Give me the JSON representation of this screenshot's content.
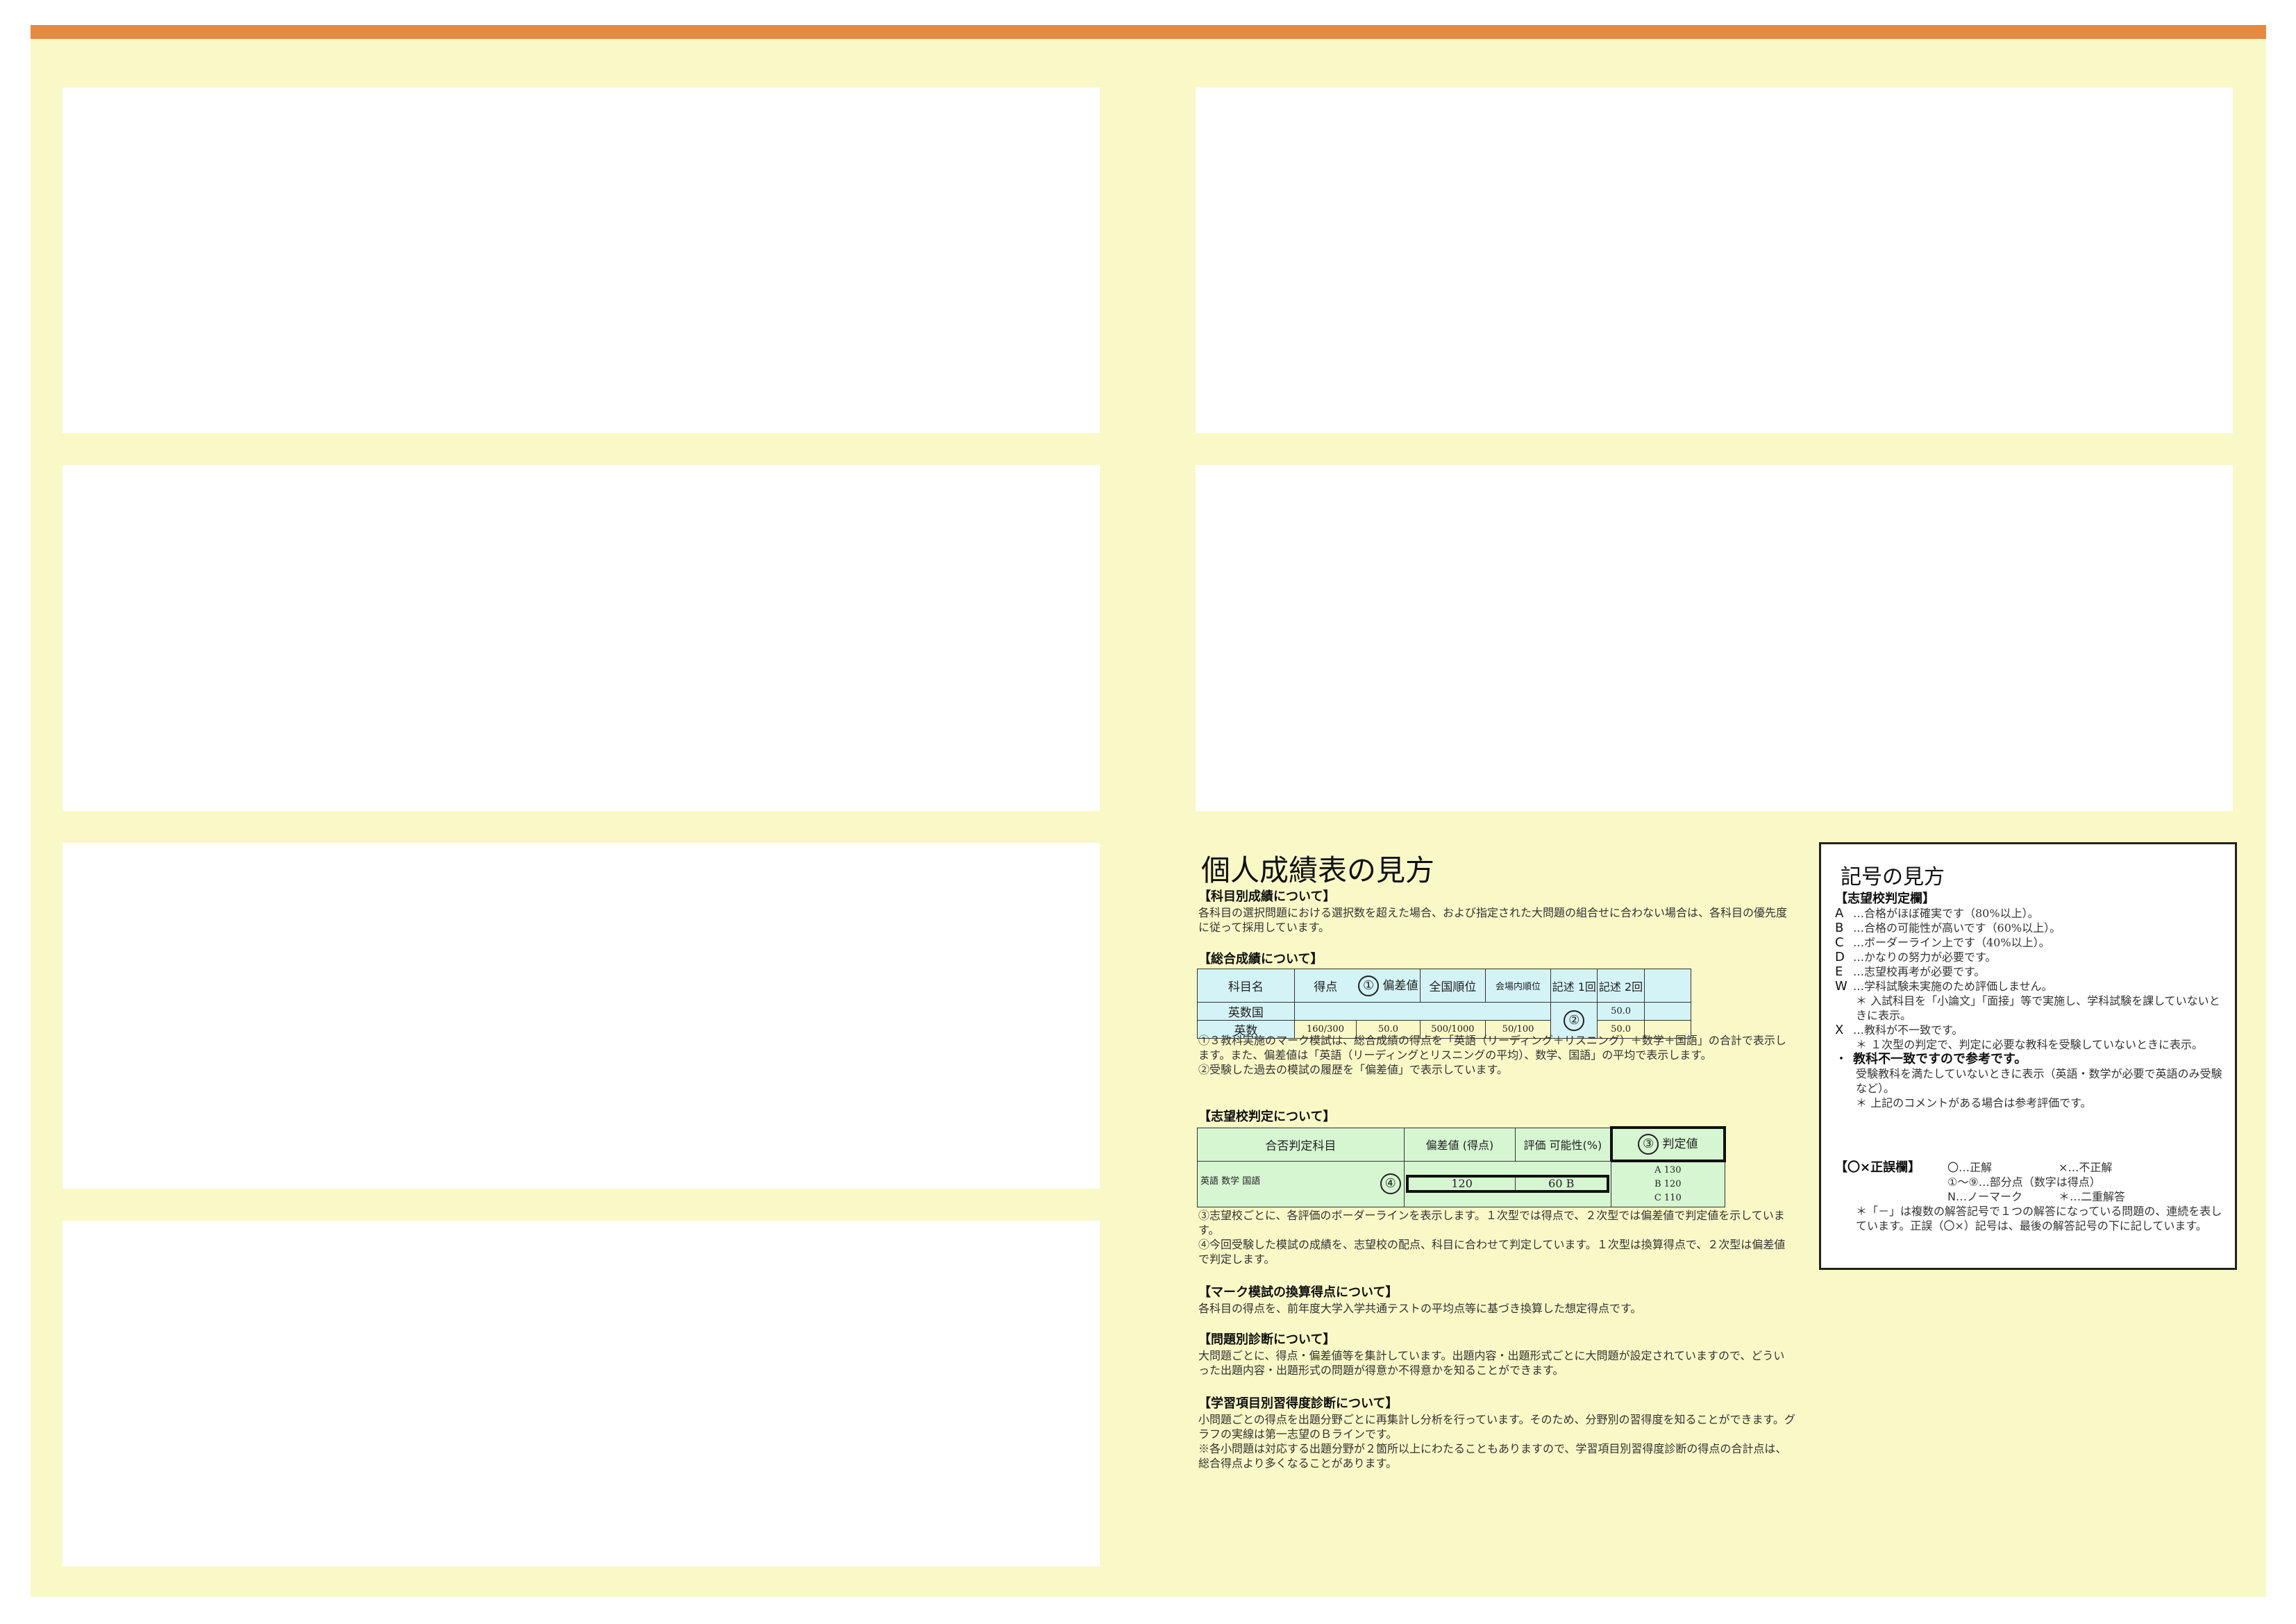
{
  "guide": {
    "title": "個人成績表の見方",
    "subject": {
      "heading": "【科目別成績について】",
      "text": "各科目の選択問題における選択数を超えた場合、および指定された大問題の組合せに合わない場合は、各科目の優先度に従って採用しています。"
    },
    "total": {
      "heading": "【総合成績について】",
      "table": {
        "h_subject": "科目名",
        "h_score": "得点",
        "h_dev": "偏差値",
        "h_nat": "全国順位",
        "h_site": "会場内順位",
        "h_k1": "記述 1回",
        "h_k2": "記述 2回",
        "row1": "英数国",
        "row2": "英数",
        "score": "160/300",
        "dev": "50.0",
        "nat": "500/1000",
        "site": "50/100",
        "k2a": "50.0",
        "k2b": "50.0"
      },
      "note1": "①３教科実施のマーク模試は、総合成績の得点を「英語（リーディング＋リスニング）＋数学＋国語」の合計で表示します。また、偏差値は「英語（リーディングとリスニングの平均）、数学、国語」の平均で表示します。",
      "note2": "②受験した過去の模試の履歴を「偏差値」で表示しています。"
    },
    "judge": {
      "heading": "【志望校判定について】",
      "table": {
        "h_subj": "合否判定科目",
        "h_dev": "偏差値 (得点)",
        "h_eval": "評価 可能性(%)",
        "h_val": "判定値",
        "subjects": "英語 数学 国語",
        "dev": "120",
        "eval": "60 B",
        "lines": [
          "A 130",
          "B 120",
          "C 110"
        ]
      },
      "note3": "③志望校ごとに、各評価のボーダーラインを表示します。１次型では得点で、２次型では偏差値で判定値を示しています。",
      "note4": "④今回受験した模試の成績を、志望校の配点、科目に合わせて判定しています。１次型は換算得点で、２次型は偏差値で判定します。"
    },
    "converted": {
      "heading": "【マーク模試の換算得点について】",
      "text": "各科目の得点を、前年度大学入学共通テストの平均点等に基づき換算した想定得点です。"
    },
    "question": {
      "heading": "【問題別診断について】",
      "text": "大問題ごとに、得点・偏差値等を集計しています。出題内容・出題形式ごとに大問題が設定されていますので、どういった出題内容・出題形式の問題が得意か不得意かを知ることができます。"
    },
    "learning": {
      "heading": "【学習項目別習得度診断について】",
      "text1": "小問題ごとの得点を出題分野ごとに再集計し分析を行っています。そのため、分野別の習得度を知ることができます。グラフの実線は第一志望のＢラインです。",
      "text2": "※各小問題は対応する出題分野が２箇所以上にわたることもありますので、学習項目別習得度診断の得点の合計点は、総合得点より多くなることがあります。"
    },
    "markers": [
      "①",
      "②",
      "③",
      "④"
    ]
  },
  "legend": {
    "title": "記号の見方",
    "judge_heading": "【志望校判定欄】",
    "items": [
      {
        "code": "A",
        "text": "…合格がほぼ確実です（80%以上）。"
      },
      {
        "code": "B",
        "text": "…合格の可能性が高いです（60%以上）。"
      },
      {
        "code": "C",
        "text": "…ボーダーライン上です（40%以上）。"
      },
      {
        "code": "D",
        "text": "…かなりの努力が必要です。"
      },
      {
        "code": "E",
        "text": "…志望校再考が必要です。"
      },
      {
        "code": "W",
        "text": "…学科試験未実施のため評価しません。"
      }
    ],
    "w_note": "＊ 入試科目を「小論文」「面接」等で実施し、学科試験を課していないときに表示。",
    "x_code": "X",
    "x_text": "…教科が不一致です。",
    "x_note": "＊ １次型の判定で、判定に必要な教科を受験していないときに表示。",
    "dot_code": "・",
    "dot_text": "教科不一致ですので参考です。",
    "dot_note1": "受験教科を満たしていないときに表示（英語・数学が必要で英語のみ受験など）。",
    "dot_note2": "＊ 上記のコメントがある場合は参考評価です。",
    "ox_heading": "【〇×正誤欄】",
    "ox_1": "〇…正解",
    "ox_2": "×…不正解",
    "ox_3": "①〜⑨…部分点（数字は得点）",
    "ox_4": "N…ノーマーク",
    "ox_5": "＊…二重解答",
    "ox_note": "＊「－」は複数の解答記号で１つの解答になっている問題の、連続を表しています。正誤（〇×）記号は、最後の解答記号の下に記しています。"
  }
}
